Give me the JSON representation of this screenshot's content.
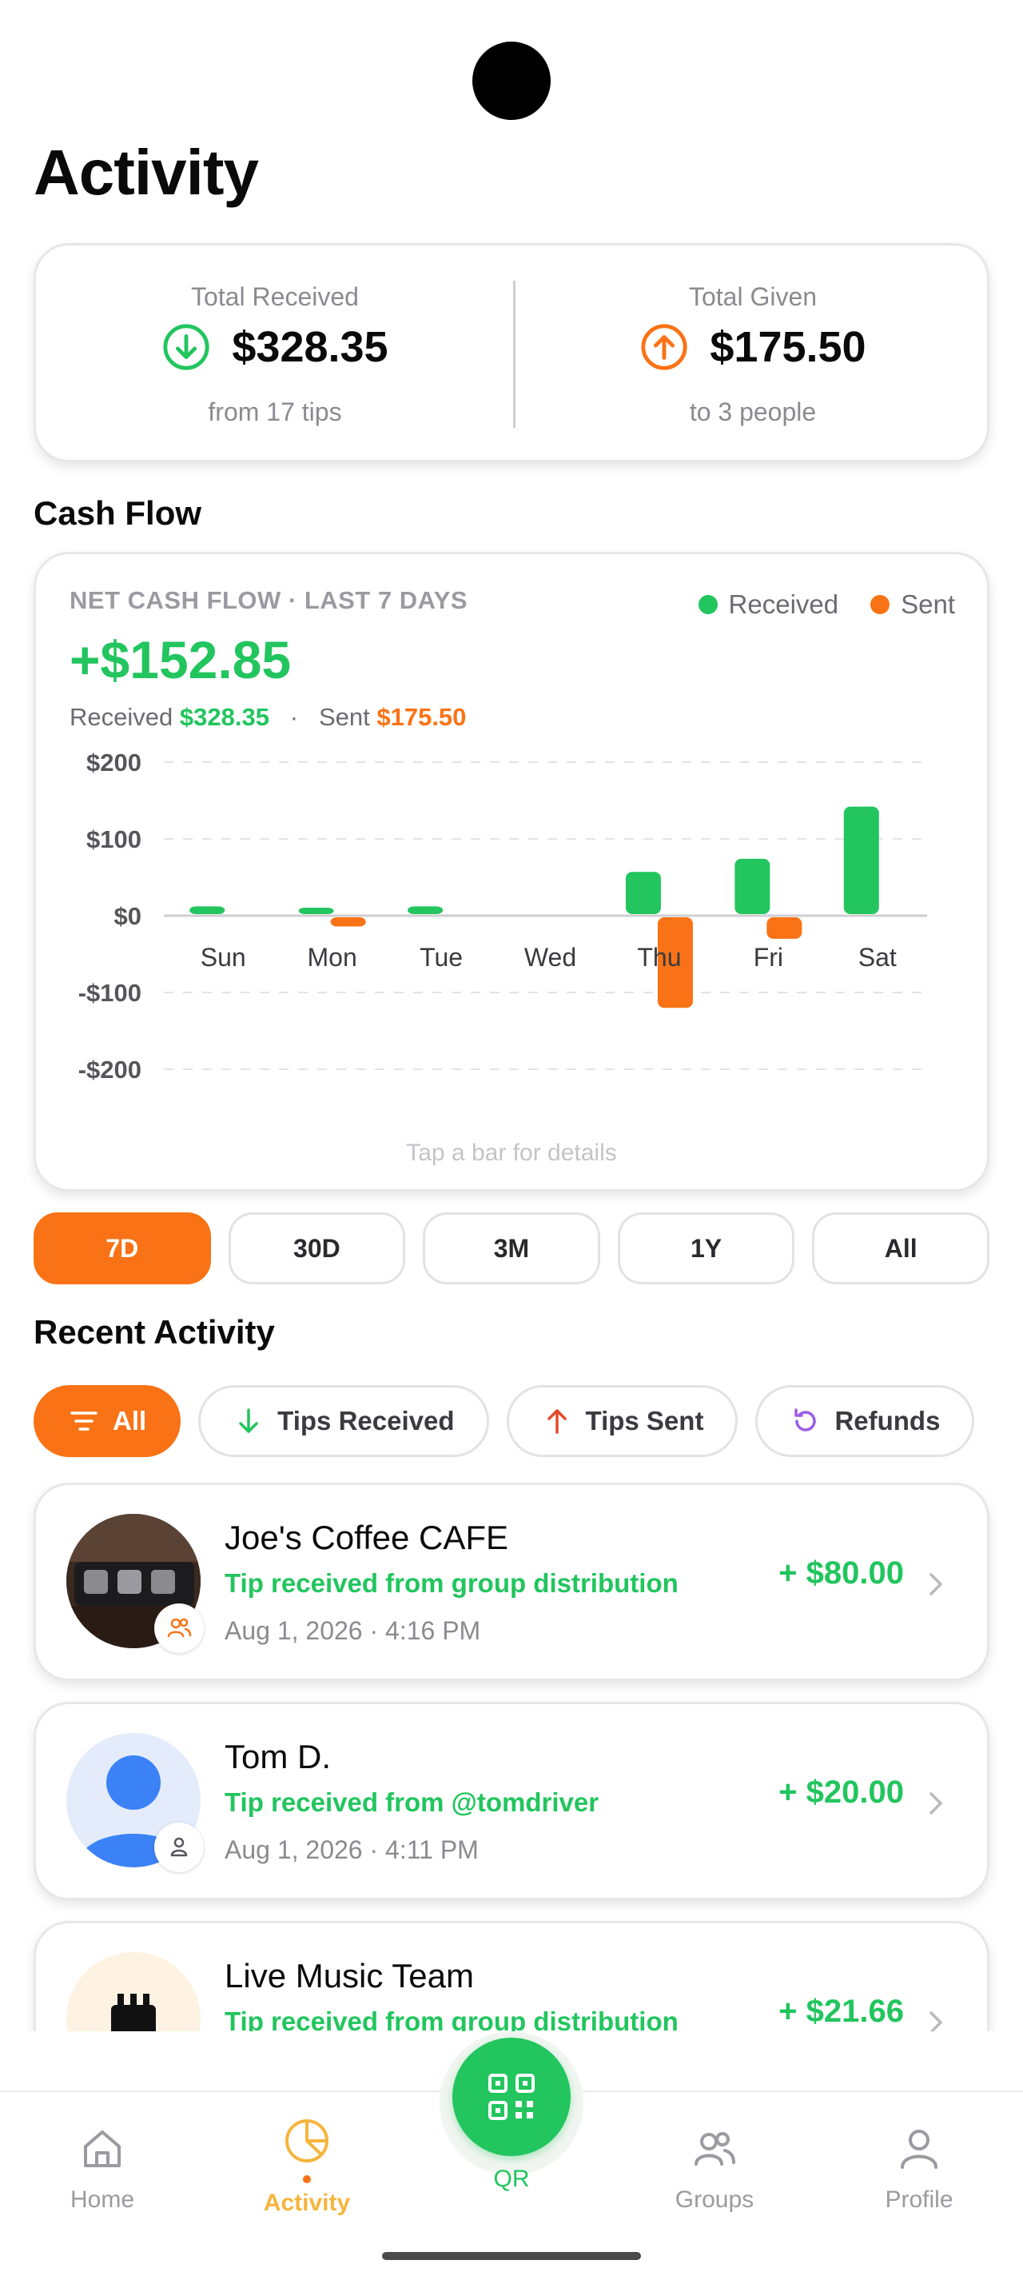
{
  "header": {
    "title": "Activity"
  },
  "totals": {
    "received": {
      "label": "Total Received",
      "amount": "$328.35",
      "sub": "from 17 tips"
    },
    "given": {
      "label": "Total Given",
      "amount": "$175.50",
      "sub": "to 3 people"
    }
  },
  "cash_flow": {
    "section_title": "Cash Flow",
    "caption": "NET CASH FLOW · LAST 7 DAYS",
    "net": "+$152.85",
    "received_label": "Received",
    "received_value": "$328.35",
    "separator": "·",
    "sent_label": "Sent",
    "sent_value": "$175.50",
    "hint": "Tap a bar for details",
    "legend": {
      "received": "Received",
      "sent": "Sent"
    }
  },
  "chart_data": {
    "type": "bar",
    "categories": [
      "Sun",
      "Mon",
      "Tue",
      "Wed",
      "Thu",
      "Fri",
      "Sat"
    ],
    "series": [
      {
        "name": "Received",
        "color": "#22c55e",
        "values": [
          10,
          5,
          10,
          0,
          55,
          72,
          140
        ]
      },
      {
        "name": "Sent",
        "color": "#f97316",
        "values": [
          0,
          -12,
          0,
          0,
          -118,
          -28,
          0
        ]
      }
    ],
    "yticks": [
      "$200",
      "$100",
      "$0",
      "-$100",
      "-$200"
    ],
    "ytick_values": [
      200,
      100,
      0,
      -100,
      -200
    ],
    "ylim": [
      -200,
      200
    ],
    "grid": true,
    "legend_position": "top-right"
  },
  "range": {
    "options": [
      "7D",
      "30D",
      "3M",
      "1Y",
      "All"
    ],
    "selected": "7D"
  },
  "recent": {
    "section_title": "Recent Activity",
    "filters": [
      {
        "label": "All",
        "icon": "filter-icon"
      },
      {
        "label": "Tips Received",
        "icon": "arrow-down-icon"
      },
      {
        "label": "Tips Sent",
        "icon": "arrow-up-icon"
      },
      {
        "label": "Refunds",
        "icon": "refresh-icon"
      }
    ],
    "items": [
      {
        "name": "Joe's Coffee CAFE",
        "desc": "Tip received from group distribution",
        "time": "Aug 1, 2026 · 4:16 PM",
        "amount": "+ $80.00",
        "badge": "group-icon"
      },
      {
        "name": "Tom D.",
        "desc": "Tip received from @tomdriver",
        "time": "Aug 1, 2026 · 4:11 PM",
        "amount": "+ $20.00",
        "badge": "person-icon"
      },
      {
        "name": "Live Music Team",
        "desc": "Tip received from group distribution",
        "time": "",
        "amount": "+ $21.66",
        "badge": ""
      }
    ]
  },
  "nav": {
    "items": [
      {
        "label": "Home",
        "icon": "home-icon"
      },
      {
        "label": "Activity",
        "icon": "pie-chart-icon"
      },
      {
        "label": "QR",
        "icon": "qr-code-icon"
      },
      {
        "label": "Groups",
        "icon": "groups-icon"
      },
      {
        "label": "Profile",
        "icon": "profile-icon"
      }
    ],
    "active": "Activity"
  },
  "colors": {
    "green": "#22c55e",
    "orange": "#f97316",
    "activity_yellow": "#f5b53d"
  }
}
